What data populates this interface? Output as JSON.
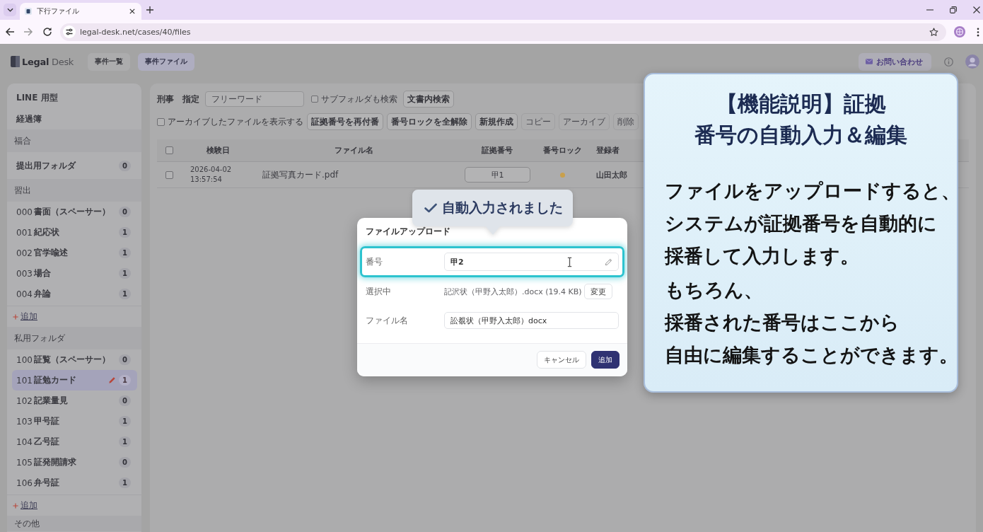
{
  "browser": {
    "tab": {
      "title": "下行ファイル"
    },
    "url": "legal-desk.net/cases/40/files"
  },
  "header": {
    "logo": "**Legal** Desk",
    "nav": [
      {
        "label": "事件一覧",
        "selected": false
      },
      {
        "label": "事件ファイル",
        "selected": true
      }
    ],
    "contact_button": "お問い合わせ"
  },
  "sidebar": {
    "items": [
      {
        "kind": "link",
        "label": "LINE 用型"
      },
      {
        "kind": "link",
        "label": "経過簿"
      },
      {
        "kind": "section",
        "label": "福合"
      },
      {
        "kind": "folder",
        "name": "提出用フォルダ",
        "count": "0",
        "selected": false
      },
      {
        "kind": "section",
        "label": "習出"
      },
      {
        "kind": "folder",
        "number": "000",
        "name": "書面（スペーサー）",
        "count": "0",
        "selected": false
      },
      {
        "kind": "folder",
        "number": "001",
        "name": "紀応状",
        "count": "1",
        "selected": false
      },
      {
        "kind": "folder",
        "number": "002",
        "name": "官学喩述",
        "count": "1",
        "selected": false
      },
      {
        "kind": "folder",
        "number": "003",
        "name": "場合",
        "count": "1",
        "selected": false
      },
      {
        "kind": "folder",
        "number": "004",
        "name": "弁論",
        "count": "1",
        "selected": false
      },
      {
        "kind": "add",
        "label": "追加"
      },
      {
        "kind": "section",
        "label": "私用フォルダ"
      },
      {
        "kind": "folder",
        "number": "100",
        "name": "証覧（スペーサー）",
        "count": "0",
        "selected": false
      },
      {
        "kind": "folder",
        "number": "101",
        "name": "証勉カード",
        "count": "1",
        "selected": true
      },
      {
        "kind": "folder",
        "number": "102",
        "name": "記業量見",
        "count": "0",
        "selected": false
      },
      {
        "kind": "folder",
        "number": "103",
        "name": "甲号証",
        "count": "1",
        "selected": false
      },
      {
        "kind": "folder",
        "number": "104",
        "name": "乙号証",
        "count": "1",
        "selected": false
      },
      {
        "kind": "folder",
        "number": "105",
        "name": "証発開請求",
        "count": "0",
        "selected": false
      },
      {
        "kind": "folder",
        "number": "106",
        "name": "弁号証",
        "count": "1",
        "selected": false
      },
      {
        "kind": "add",
        "label": "追加"
      },
      {
        "kind": "section",
        "label": "その他"
      }
    ]
  },
  "toolbar": {
    "filters": [
      "刑事",
      "指定"
    ],
    "search": {
      "placeholder": "フリーワード"
    },
    "subfolder_check": {
      "label": "サブフォルダも検索",
      "checked": false
    },
    "doc_search_button": "文書内検索",
    "archive_check": {
      "label": "アーカイブしたファイルを表示する",
      "checked": false
    },
    "actions": [
      {
        "label": "証拠番号を再付番",
        "disabled": false
      },
      {
        "label": "番号ロックを全解除",
        "disabled": false
      },
      {
        "label": "新規作成",
        "disabled": false
      },
      {
        "label": "コピー",
        "disabled": true
      },
      {
        "label": "アーカイブ",
        "disabled": true
      },
      {
        "label": "削除",
        "disabled": true
      }
    ]
  },
  "table": {
    "select_all": {
      "checked": false
    },
    "columns": [
      "検験日",
      "ファイル名",
      "証拠番号",
      "番号ロック",
      "登録者"
    ],
    "rows": [
      {
        "checked": false,
        "date": "2026-04-02",
        "time": "13:57:54",
        "file_name": "証拠写真カード.pdf",
        "number": "甲1",
        "locked": true,
        "registrant": "山田太郎"
      }
    ]
  },
  "dialog": {
    "tooltip": "自動入力されました",
    "title": "ファイルアップロード",
    "fields": [
      {
        "kind": "input",
        "label": "番号",
        "value": "甲2",
        "highlighted": true
      },
      {
        "kind": "file",
        "label": "選択中",
        "value": "記沢状（甲野入太郎）.docx (19.4 KB)",
        "button": "変更"
      },
      {
        "kind": "input",
        "label": "ファイル名",
        "value": "訟覩状（甲野入太郎）docx",
        "highlighted": false
      }
    ],
    "buttons": [
      {
        "label": "キャンセル",
        "primary": false
      },
      {
        "label": "追加",
        "primary": true
      }
    ]
  },
  "explainer": {
    "title_lines": [
      "【機能説明】証拠",
      "番号の自動入力＆編集"
    ],
    "paragraphs": [
      [
        "ファイルをアップロードすると、",
        "システムが証拠番号を自動的に",
        "採番して入力します。"
      ],
      [
        "もちろん、",
        "採番された番号はここから",
        "自由に編集することができます。"
      ]
    ]
  }
}
